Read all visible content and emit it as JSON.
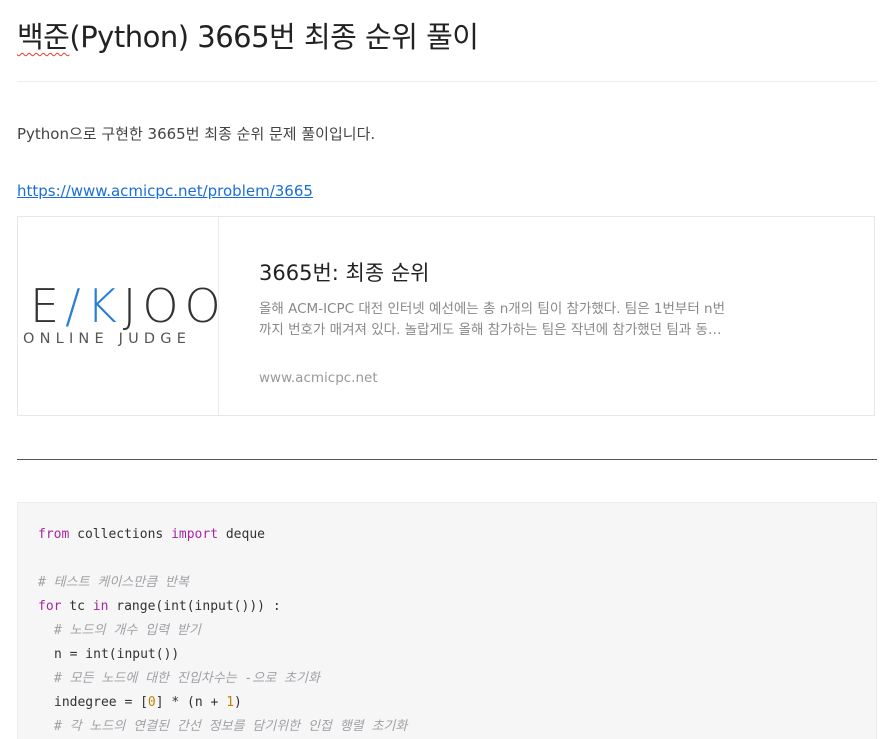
{
  "post": {
    "title_prefix": "백준",
    "title_rest": "(Python) 3665번 최종 순위 풀이",
    "intro": "Python으로 구현한 3665번 최종 순위 문제 풀이입니다.",
    "link": "https://www.acmicpc.net/problem/3665"
  },
  "card": {
    "logo_word": "E/KJOO",
    "logo_sub": "ONLINE JUDGE",
    "title": "3665번: 최종 순위",
    "description": "올해 ACM-ICPC 대전 인터넷 예선에는 총 n개의 팀이 참가했다. 팀은 1번부터 n번까지 번호가 매겨져 있다. 놀랍게도 올해 참가하는 팀은 작년에 참가했던 팀과 동일하다. 올해는 인터넷 예선 본부에서는 최종 순위를 발표하지 않기로 했다.",
    "url": "www.acmicpc.net"
  },
  "code": {
    "l1_kw1": "from",
    "l1_t1": " collections ",
    "l1_kw2": "import",
    "l1_t2": " deque",
    "l3": "# 테스트 케이스만큼 반복",
    "l4_kw1": "for",
    "l4_t1": " tc ",
    "l4_kw2": "in",
    "l4_t2": " range(int(input())) :",
    "l5": "# 노드의 개수 입력 받기",
    "l6": "n = int(input())",
    "l7": "# 모든 노드에 대한 진입차수는 -으로 초기화",
    "l8_t1": "indegree = [",
    "l8_n1": "0",
    "l8_t2": "] * (n + ",
    "l8_n2": "1",
    "l8_t3": ")",
    "l9": "# 각 노드의 연결된 간선 정보를 담기위한 인접 행렬 초기화"
  },
  "colors": {
    "link": "#1a6ed8",
    "keyword": "#a626a4",
    "comment": "#a0a1a7",
    "number": "#c18401",
    "logo_accent": "#2a7fd1"
  }
}
